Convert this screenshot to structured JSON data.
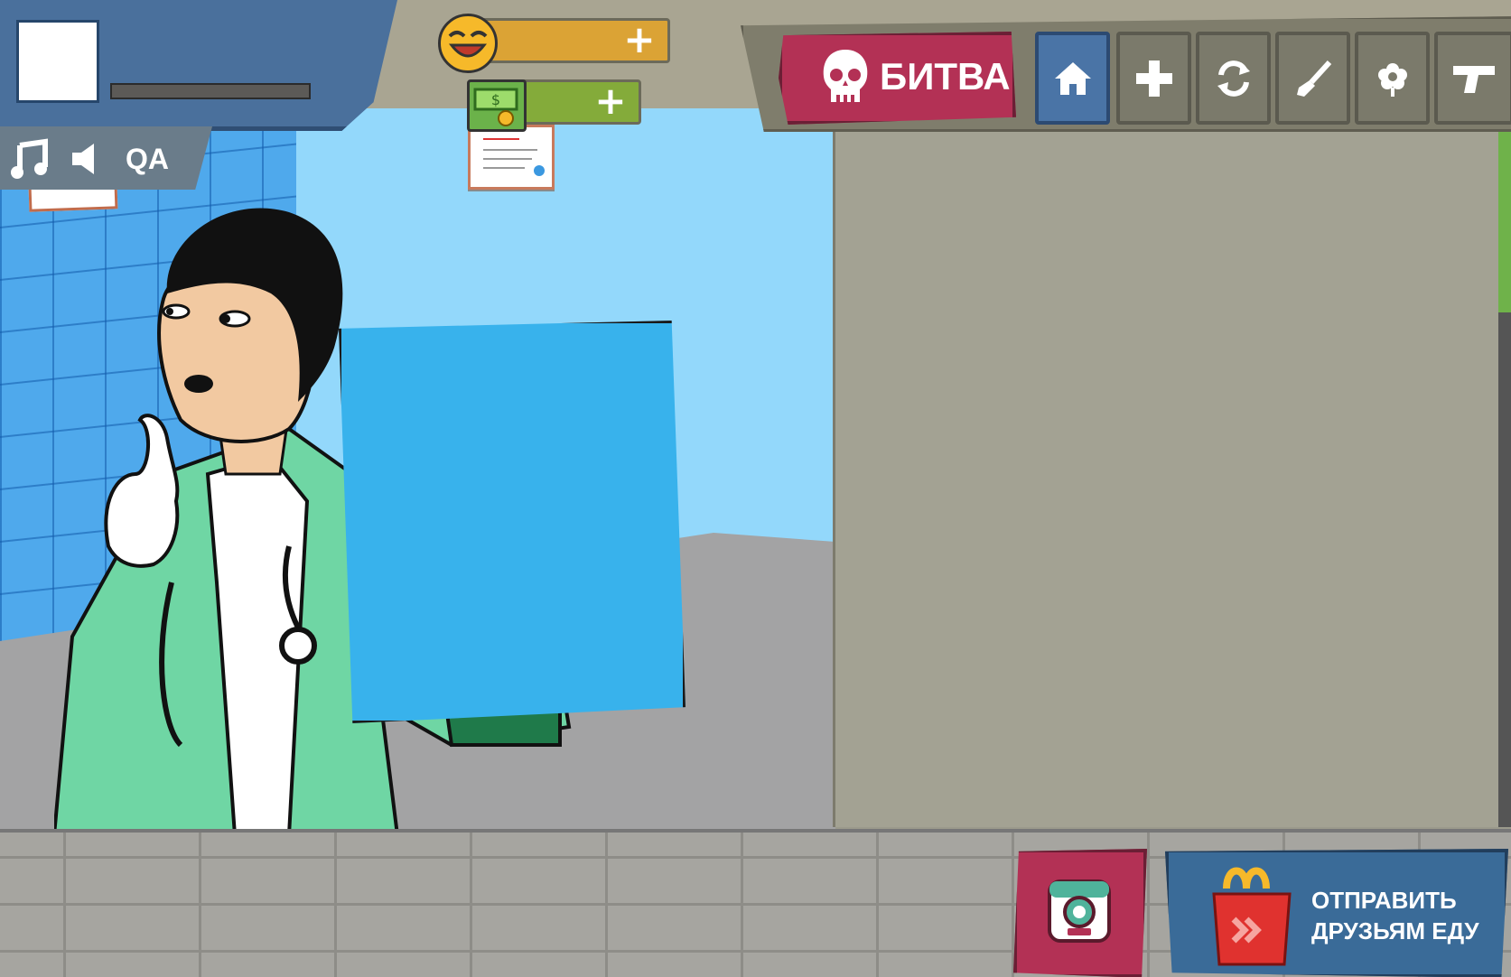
{
  "profile": {
    "name": "",
    "xp_progress": 0
  },
  "settings": {
    "qa_label": "QA",
    "music_icon": "music-note-icon",
    "sound_icon": "speaker-icon"
  },
  "currency": {
    "smile_icon": "laughing-face-icon",
    "money_icon": "cash-stack-icon",
    "smile_plus": "+",
    "money_plus": "+"
  },
  "nav": {
    "battle_label": "БИТВА",
    "battle_icon": "skull-icon",
    "items": [
      {
        "id": "home",
        "icon": "home-icon",
        "active": true
      },
      {
        "id": "health",
        "icon": "plus-icon",
        "active": false
      },
      {
        "id": "swap",
        "icon": "swap-arrows-icon",
        "active": false
      },
      {
        "id": "brush",
        "icon": "paint-brush-icon",
        "active": false
      },
      {
        "id": "flower",
        "icon": "flower-icon",
        "active": false
      },
      {
        "id": "gun",
        "icon": "pistol-icon",
        "active": false
      }
    ]
  },
  "sign": {
    "text": ""
  },
  "bottom": {
    "camera_icon": "camera-icon",
    "send_food_label_line1": "ОТПРАВИТЬ",
    "send_food_label_line2": "ДРУЗЬЯМ ЕДУ",
    "send_food_icon": "happy-meal-box-icon"
  },
  "colors": {
    "battle_red": "#b33155",
    "home_blue": "#4a74a6",
    "sign_blue": "#38b2ec",
    "panel_olive": "#a3a293",
    "scrub_green": "#6fd6a4"
  }
}
